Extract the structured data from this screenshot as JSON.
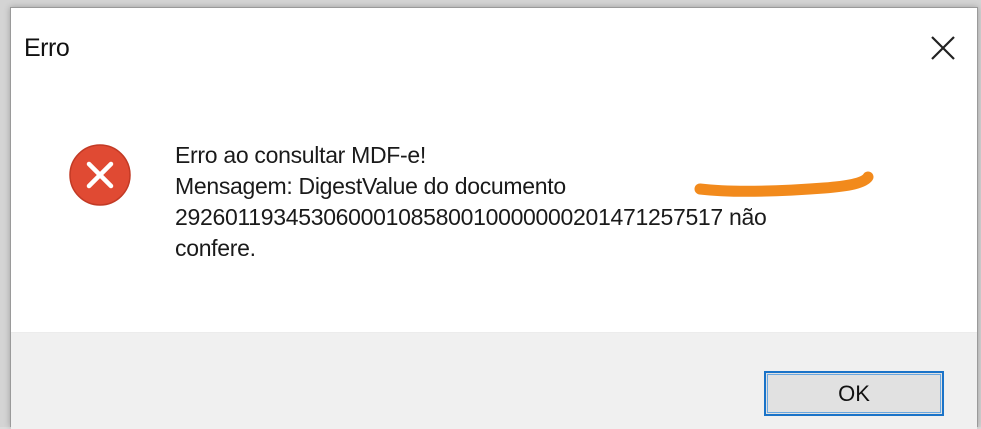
{
  "dialog": {
    "title": "Erro",
    "close_icon": "close-icon",
    "icon": "error-icon",
    "message_lines": [
      "Erro ao consultar MDF-e!",
      "Mensagem: DigestValue do documento",
      "29260119345306000108580010000000201471257517 não",
      "confere."
    ],
    "ok_label": "OK"
  },
  "colors": {
    "error_icon": "#e04a33",
    "redaction_mark": "#f28a1c",
    "button_focus_border": "#1a73c8",
    "footer_bg": "#f0f0f0"
  }
}
